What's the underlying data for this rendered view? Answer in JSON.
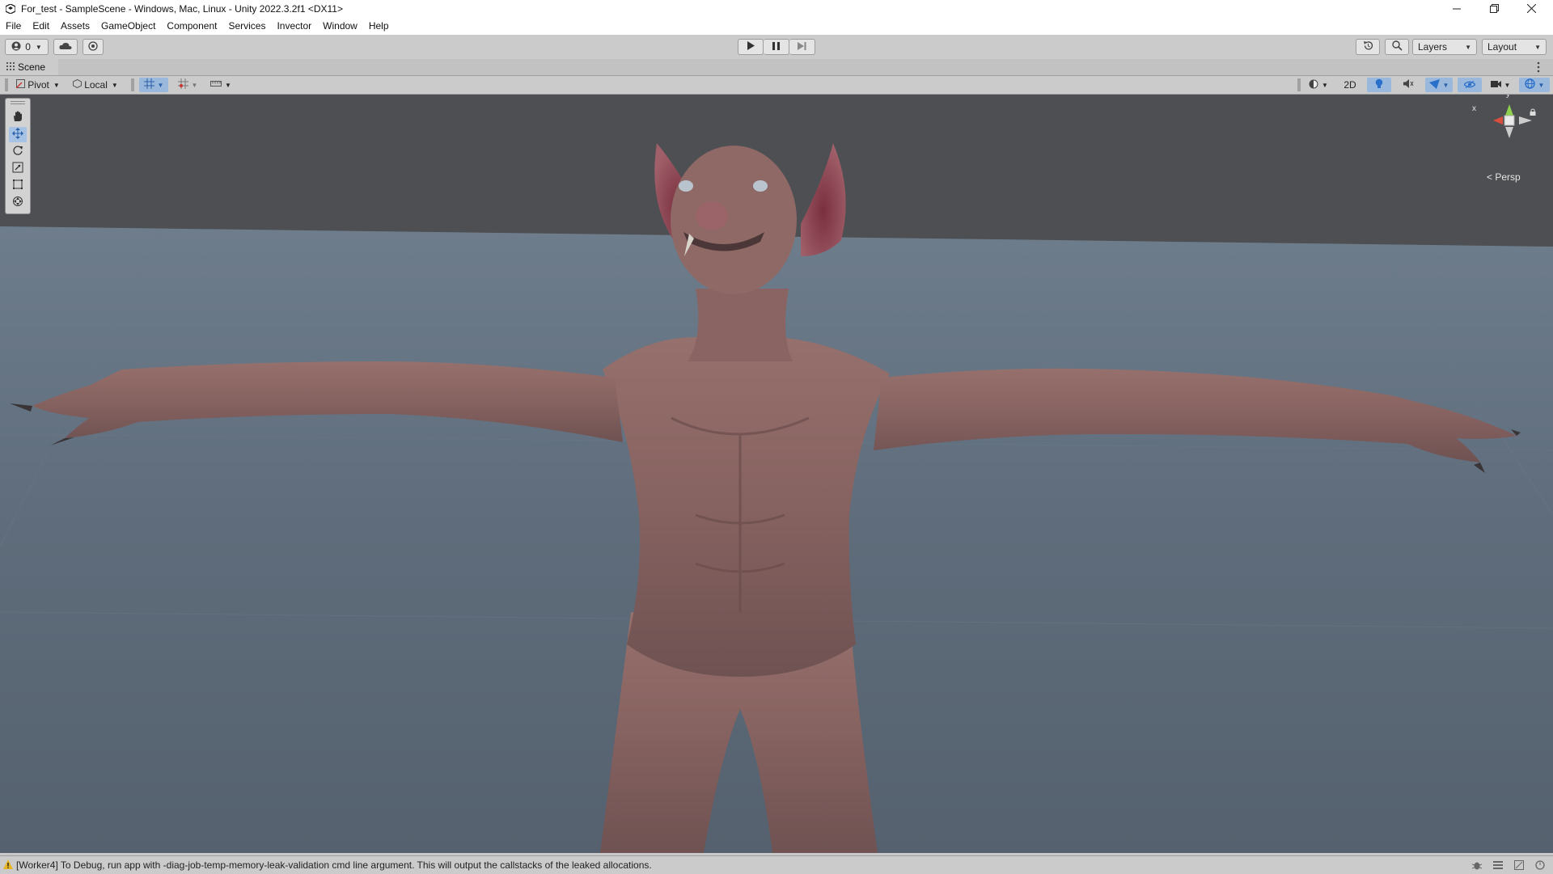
{
  "window": {
    "title": "For_test - SampleScene - Windows, Mac, Linux - Unity 2022.3.2f1 <DX11>"
  },
  "menu": [
    "File",
    "Edit",
    "Assets",
    "GameObject",
    "Component",
    "Services",
    "Invector",
    "Window",
    "Help"
  ],
  "toolbar": {
    "account_count": "0",
    "layers_label": "Layers",
    "layout_label": "Layout"
  },
  "scene_tab": {
    "label": "Scene"
  },
  "scene_toolbar": {
    "pivot_label": "Pivot",
    "local_label": "Local",
    "mode_2d_label": "2D"
  },
  "gizmo": {
    "x_label": "x",
    "y_label": "y",
    "projection_label": "Persp"
  },
  "status": {
    "message": "[Worker4] To Debug, run app with -diag-job-temp-memory-leak-validation cmd line argument. This will output the callstacks of the leaked allocations."
  },
  "colors": {
    "sky": "#4d4f52",
    "floor": "#5e6b7a",
    "skin": "#8a6462",
    "active_tool": "#a6c3e6"
  },
  "icons": {
    "tools": [
      "hand-icon",
      "move-icon",
      "rotate-icon",
      "scale-icon",
      "rect-icon",
      "transform-icon"
    ]
  }
}
